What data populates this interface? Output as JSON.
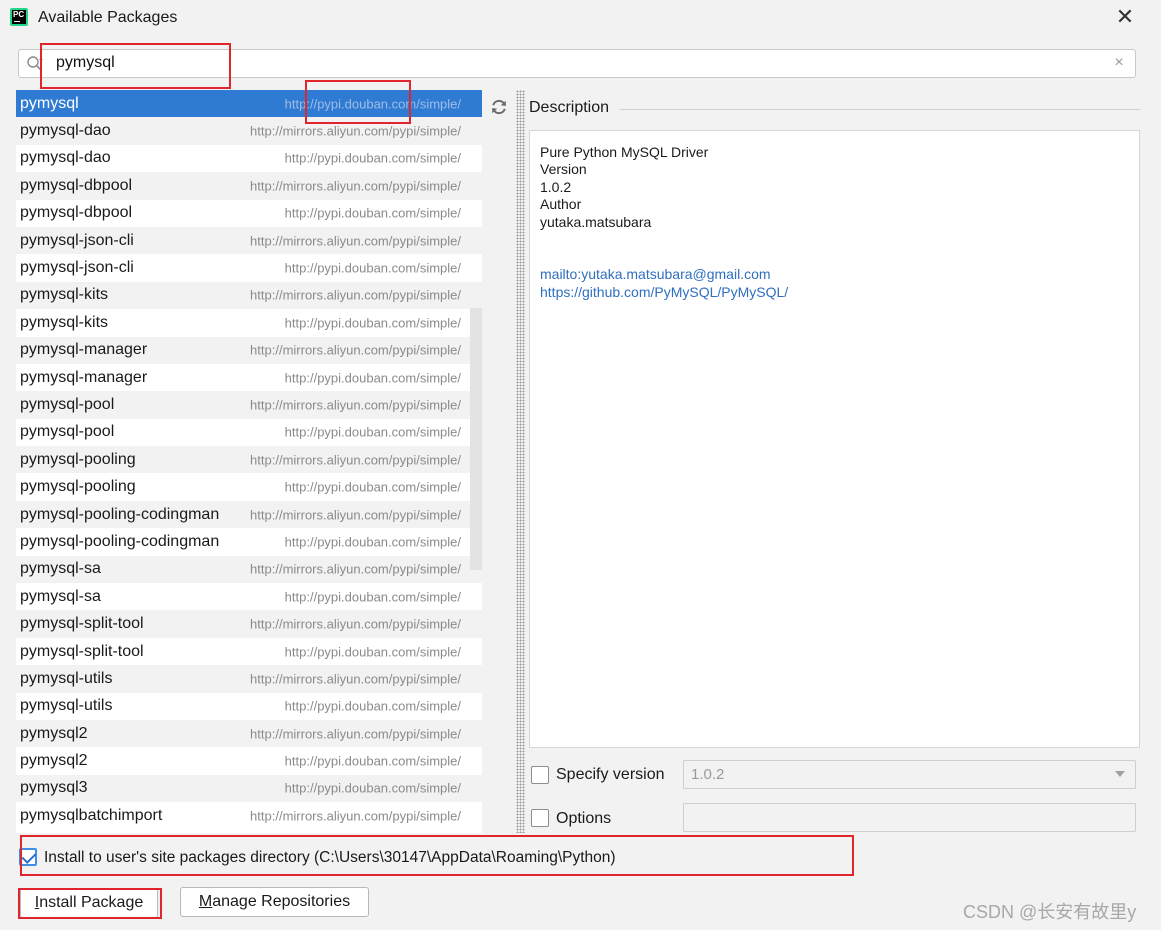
{
  "window": {
    "title": "Available Packages",
    "close_glyph": "✕",
    "app_icon": "pycharm-icon",
    "app_icon_text": "PC"
  },
  "search": {
    "value": "pymysql",
    "clear_glyph": "×"
  },
  "packages": [
    {
      "name": "pymysql",
      "repo": "http://pypi.douban.com/simple/",
      "selected": true
    },
    {
      "name": "pymysql-dao",
      "repo": "http://mirrors.aliyun.com/pypi/simple/"
    },
    {
      "name": "pymysql-dao",
      "repo": "http://pypi.douban.com/simple/"
    },
    {
      "name": "pymysql-dbpool",
      "repo": "http://mirrors.aliyun.com/pypi/simple/"
    },
    {
      "name": "pymysql-dbpool",
      "repo": "http://pypi.douban.com/simple/"
    },
    {
      "name": "pymysql-json-cli",
      "repo": "http://mirrors.aliyun.com/pypi/simple/"
    },
    {
      "name": "pymysql-json-cli",
      "repo": "http://pypi.douban.com/simple/"
    },
    {
      "name": "pymysql-kits",
      "repo": "http://mirrors.aliyun.com/pypi/simple/"
    },
    {
      "name": "pymysql-kits",
      "repo": "http://pypi.douban.com/simple/"
    },
    {
      "name": "pymysql-manager",
      "repo": "http://mirrors.aliyun.com/pypi/simple/"
    },
    {
      "name": "pymysql-manager",
      "repo": "http://pypi.douban.com/simple/"
    },
    {
      "name": "pymysql-pool",
      "repo": "http://mirrors.aliyun.com/pypi/simple/"
    },
    {
      "name": "pymysql-pool",
      "repo": "http://pypi.douban.com/simple/"
    },
    {
      "name": "pymysql-pooling",
      "repo": "http://mirrors.aliyun.com/pypi/simple/"
    },
    {
      "name": "pymysql-pooling",
      "repo": "http://pypi.douban.com/simple/"
    },
    {
      "name": "pymysql-pooling-codingman",
      "repo": "http://mirrors.aliyun.com/pypi/simple/",
      "overlap": true
    },
    {
      "name": "pymysql-pooling-codingman",
      "repo": "http://pypi.douban.com/simple/"
    },
    {
      "name": "pymysql-sa",
      "repo": "http://mirrors.aliyun.com/pypi/simple/"
    },
    {
      "name": "pymysql-sa",
      "repo": "http://pypi.douban.com/simple/"
    },
    {
      "name": "pymysql-split-tool",
      "repo": "http://mirrors.aliyun.com/pypi/simple/"
    },
    {
      "name": "pymysql-split-tool",
      "repo": "http://pypi.douban.com/simple/"
    },
    {
      "name": "pymysql-utils",
      "repo": "http://mirrors.aliyun.com/pypi/simple/"
    },
    {
      "name": "pymysql-utils",
      "repo": "http://pypi.douban.com/simple/"
    },
    {
      "name": "pymysql2",
      "repo": "http://mirrors.aliyun.com/pypi/simple/"
    },
    {
      "name": "pymysql2",
      "repo": "http://pypi.douban.com/simple/"
    },
    {
      "name": "pymysql3",
      "repo": "http://pypi.douban.com/simple/"
    },
    {
      "name": "pymysqlbatchimport",
      "repo": "http://mirrors.aliyun.com/pypi/simple/"
    }
  ],
  "description": {
    "label": "Description",
    "summary": "Pure Python MySQL Driver",
    "version_label": "Version",
    "version": "1.0.2",
    "author_label": "Author",
    "author": "yutaka.matsubara",
    "email_link": "mailto:yutaka.matsubara@gmail.com",
    "home_link": "https://github.com/PyMySQL/PyMySQL/"
  },
  "options": {
    "specify_version_label": "Specify version",
    "specify_version_checked": false,
    "version_value": "1.0.2",
    "options_label": "Options",
    "options_checked": false,
    "options_value": "",
    "install_user_label": "Install to user's site packages directory (C:\\Users\\30147\\AppData\\Roaming\\Python)",
    "install_user_checked": true
  },
  "buttons": {
    "install_prefix": "I",
    "install_rest": "nstall Package",
    "manage_prefix": "M",
    "manage_rest": "anage Repositories"
  },
  "watermark": "CSDN @长安有故里y",
  "colors": {
    "selection": "#2f7bd3",
    "link": "#2f6fbf",
    "annotation": "#e0262d"
  }
}
